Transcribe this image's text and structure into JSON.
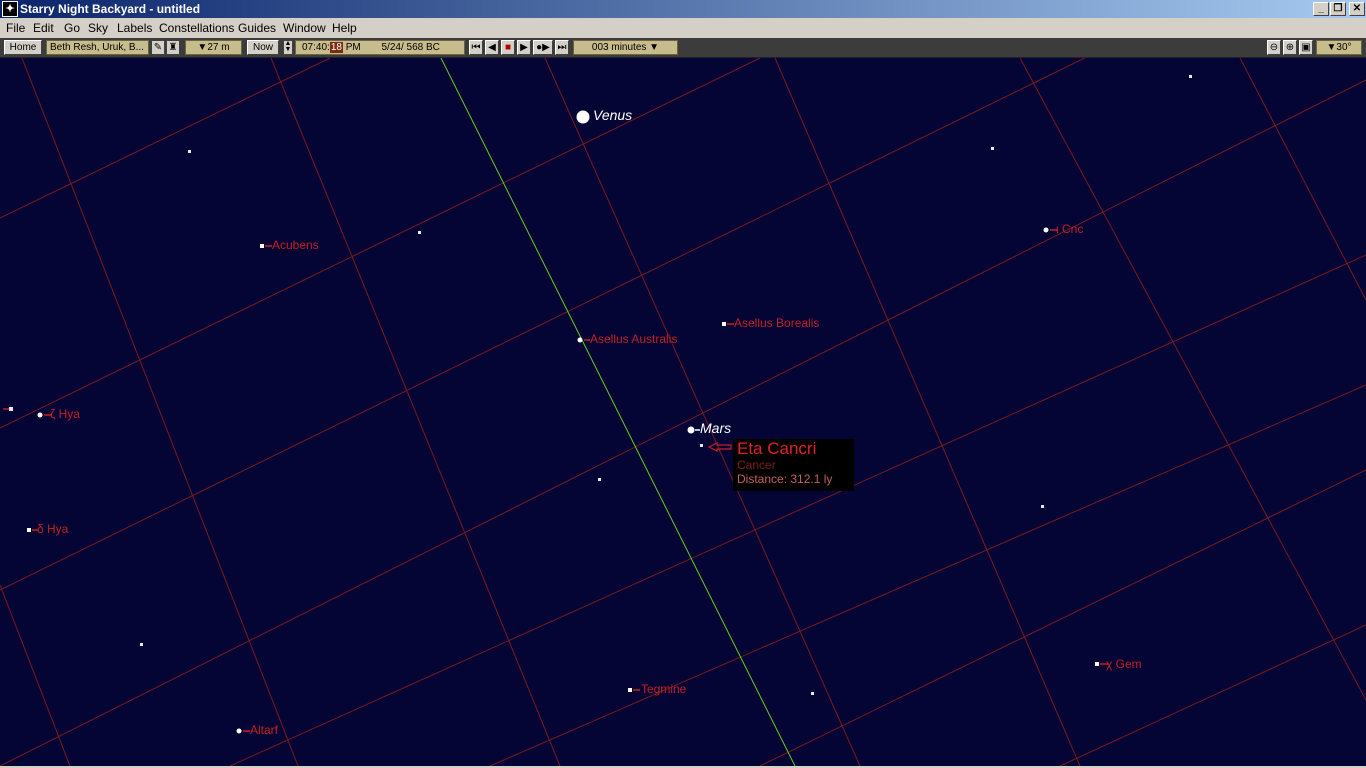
{
  "window": {
    "title": "Starry Night Backyard - untitled",
    "minimize_glyph": "_",
    "restore_glyph": "❐",
    "close_glyph": "✕"
  },
  "menu": [
    "File",
    "Edit",
    "Go",
    "Sky",
    "Labels",
    "Constellations",
    "Guides",
    "Window",
    "Help"
  ],
  "toolbar": {
    "home": "Home",
    "location": "Beth Resh, Uruk, B...",
    "elevation": "▼27 m",
    "now": "Now",
    "time": "07:40:",
    "seconds": "18",
    "ampm": "PM",
    "date": "5/24/  568 BC",
    "time_step": "003 minutes ▼",
    "field_of_view": "▼30°"
  },
  "sky": {
    "background": "#040435",
    "grid_color": "#7a1a1a",
    "ecliptic_color": "#5fd21e",
    "planets": [
      {
        "name": "Venus"
      },
      {
        "name": "Mars"
      }
    ],
    "star_labels": [
      {
        "text": "Acubens"
      },
      {
        "text": "Asellus Australis"
      },
      {
        "text": "Asellus Borealis"
      },
      {
        "text": "ι Cnc"
      },
      {
        "text": "ζ Hya"
      },
      {
        "text": "δ Hya"
      },
      {
        "text": "Tegmine"
      },
      {
        "text": "Altarf"
      },
      {
        "text": "χ Gem"
      }
    ]
  },
  "info_box": {
    "name": "Eta Cancri",
    "constellation": "Cancer",
    "distance": "Distance: 312.1 ly"
  }
}
